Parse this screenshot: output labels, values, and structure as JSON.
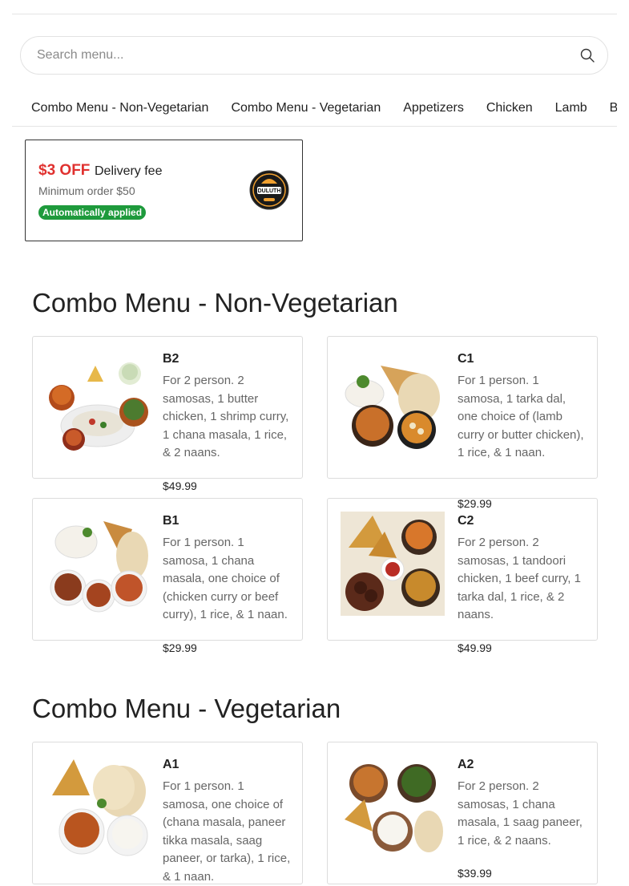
{
  "search": {
    "placeholder": "Search menu..."
  },
  "tabs": [
    "Combo Menu - Non-Vegetarian",
    "Combo Menu - Vegetarian",
    "Appetizers",
    "Chicken",
    "Lamb",
    "B"
  ],
  "promo": {
    "off": "$3 OFF",
    "fee": "Delivery fee",
    "min": "Minimum order $50",
    "badge": "Automatically applied",
    "logo_text": "DULUTH"
  },
  "sections": [
    {
      "title": "Combo Menu - Non-Vegetarian",
      "items": [
        {
          "name": "B2",
          "desc": "For 2 person. 2 samosas, 1 butter chicken, 1 shrimp curry, 1 chana masala, 1 rice, & 2 naans.",
          "price": "$49.99"
        },
        {
          "name": "C1",
          "desc": "For 1 person. 1 samosa, 1 tarka dal, one choice of (lamb curry or butter chicken), 1 rice, & 1 naan.",
          "price": "$29.99"
        },
        {
          "name": "B1",
          "desc": "For 1 person. 1 samosa, 1 chana masala, one choice of (chicken curry or beef curry), 1 rice, & 1 naan.",
          "price": "$29.99"
        },
        {
          "name": "C2",
          "desc": "For 2 person. 2 samosas, 1 tandoori chicken, 1 beef curry, 1 tarka dal, 1 rice, & 2 naans.",
          "price": "$49.99"
        }
      ]
    },
    {
      "title": "Combo Menu - Vegetarian",
      "items": [
        {
          "name": "A1",
          "desc": "For 1 person. 1 samosa, one choice of (chana masala, paneer tikka masala, saag paneer, or tarka), 1 rice, & 1 naan.",
          "price": ""
        },
        {
          "name": "A2",
          "desc": "For 2 person. 2 samosas, 1 chana masala, 1 saag paneer, 1 rice, & 2 naans.",
          "price": "$39.99"
        }
      ]
    }
  ]
}
